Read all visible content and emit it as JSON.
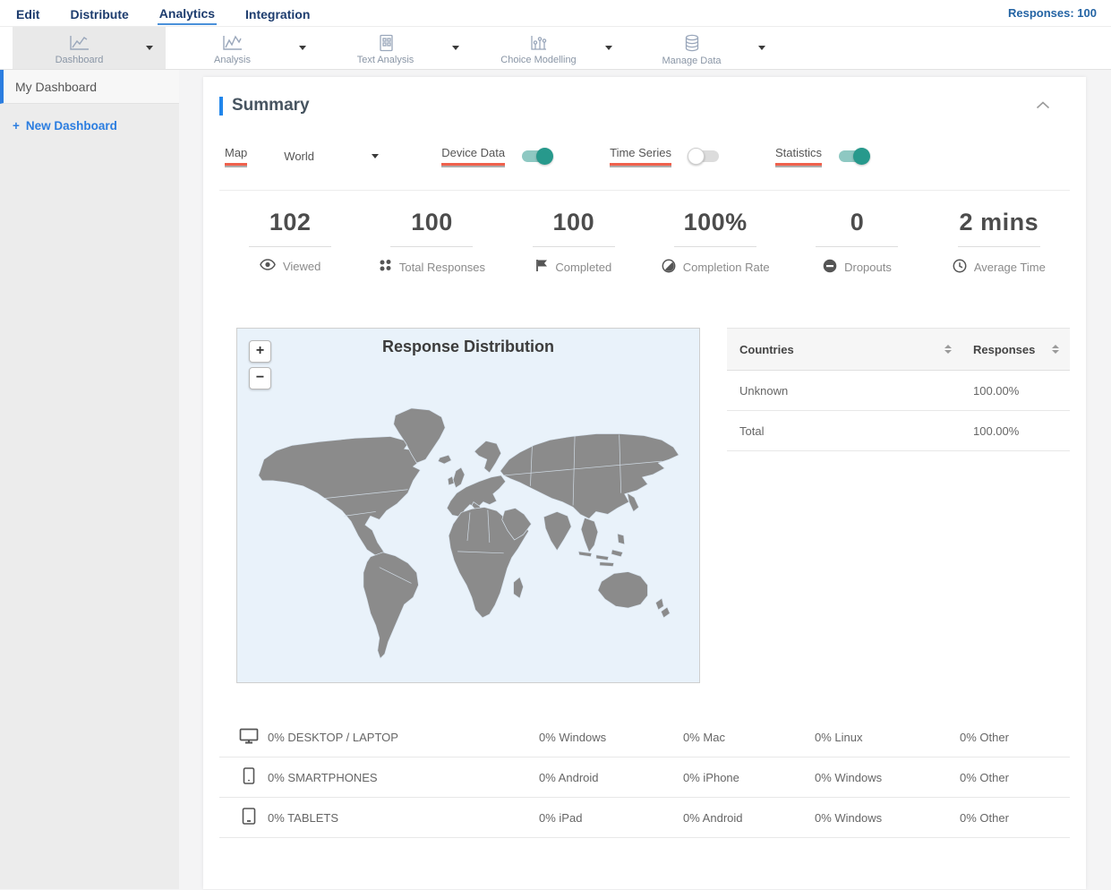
{
  "nav": {
    "items": [
      {
        "label": "Edit",
        "active": false
      },
      {
        "label": "Distribute",
        "active": false
      },
      {
        "label": "Analytics",
        "active": true
      },
      {
        "label": "Integration",
        "active": false
      }
    ],
    "responses_label": "Responses: 100"
  },
  "toolbar": {
    "items": [
      {
        "label": "Dashboard",
        "icon": "line-chart-icon",
        "selected": true
      },
      {
        "label": "Analysis",
        "icon": "line-chart-icon",
        "selected": false
      },
      {
        "label": "Text Analysis",
        "icon": "document-grid-icon",
        "selected": false
      },
      {
        "label": "Choice Modelling",
        "icon": "dot-chart-icon",
        "selected": false
      },
      {
        "label": "Manage Data",
        "icon": "database-icon",
        "selected": false
      }
    ]
  },
  "sidebar": {
    "selected_item": "My Dashboard",
    "new_dashboard": {
      "plus": "+",
      "label": "New Dashboard"
    }
  },
  "summary": {
    "title": "Summary",
    "controls": {
      "map_label": "Map",
      "map_value": "World",
      "device_data_label": "Device Data",
      "device_data_on": true,
      "time_series_label": "Time Series",
      "time_series_on": false,
      "statistics_label": "Statistics",
      "statistics_on": true
    },
    "stats": [
      {
        "value": "102",
        "label": "Viewed",
        "icon": "eye-icon"
      },
      {
        "value": "100",
        "label": "Total Responses",
        "icon": "dots-grid-icon"
      },
      {
        "value": "100",
        "label": "Completed",
        "icon": "flag-icon"
      },
      {
        "value": "100%",
        "label": "Completion Rate",
        "icon": "contrast-circle-icon"
      },
      {
        "value": "0",
        "label": "Dropouts",
        "icon": "minus-circle-icon"
      },
      {
        "value": "2 mins",
        "label": "Average Time",
        "icon": "clock-icon"
      }
    ],
    "map": {
      "title": "Response Distribution",
      "zoom_in": "+",
      "zoom_out": "−"
    },
    "countries_table": {
      "col1_header": "Countries",
      "col2_header": "Responses",
      "rows": [
        {
          "country": "Unknown",
          "responses": "100.00%"
        },
        {
          "country": "Total",
          "responses": "100.00%"
        }
      ]
    },
    "device_table": {
      "rows": [
        {
          "icon": "desktop-icon",
          "category": "0% DESKTOP / LAPTOP",
          "cols": [
            "0% Windows",
            "0% Mac",
            "0% Linux",
            "0% Other"
          ]
        },
        {
          "icon": "smartphone-icon",
          "category": "0% SMARTPHONES",
          "cols": [
            "0% Android",
            "0% iPhone",
            "0% Windows",
            "0% Other"
          ]
        },
        {
          "icon": "tablet-icon",
          "category": "0% TABLETS",
          "cols": [
            "0% iPad",
            "0% Android",
            "0% Windows",
            "0% Other"
          ]
        }
      ]
    }
  },
  "colors": {
    "nav_text": "#1d3c6e",
    "accent_blue": "#2186eb",
    "link_blue": "#2b7de0",
    "active_underline": "#4a90d9",
    "red_underline": "#ef604c",
    "toggle_on": "#27998c",
    "map_background": "#e9f2fa",
    "map_land": "#8b8b8b"
  }
}
